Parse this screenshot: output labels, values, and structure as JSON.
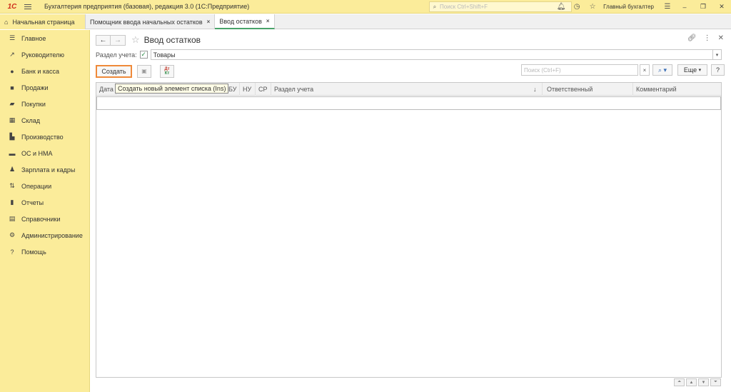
{
  "titlebar": {
    "logo": "1С",
    "app_title": "Бухгалтерия предприятия (базовая), редакция 3.0  (1С:Предприятие)",
    "search_placeholder": "Поиск Ctrl+Shift+F",
    "user": "Главный бухгалтер"
  },
  "tabs": [
    {
      "label": "Начальная страница"
    },
    {
      "label": "Помощник ввода начальных остатков"
    },
    {
      "label": "Ввод остатков"
    }
  ],
  "sidebar": {
    "items": [
      {
        "label": "Главное",
        "icon": "list-icon"
      },
      {
        "label": "Руководителю",
        "icon": "trend-icon"
      },
      {
        "label": "Банк и касса",
        "icon": "coin-icon"
      },
      {
        "label": "Продажи",
        "icon": "bag-icon"
      },
      {
        "label": "Покупки",
        "icon": "cart-icon"
      },
      {
        "label": "Склад",
        "icon": "warehouse-icon"
      },
      {
        "label": "Производство",
        "icon": "factory-icon"
      },
      {
        "label": "ОС и НМА",
        "icon": "truck-icon"
      },
      {
        "label": "Зарплата и кадры",
        "icon": "person-icon"
      },
      {
        "label": "Операции",
        "icon": "dtkt-icon"
      },
      {
        "label": "Отчеты",
        "icon": "chart-icon"
      },
      {
        "label": "Справочники",
        "icon": "book-icon"
      },
      {
        "label": "Администрирование",
        "icon": "gear-icon"
      },
      {
        "label": "Помощь",
        "icon": "help-icon"
      }
    ]
  },
  "form": {
    "title": "Ввод остатков",
    "filter_label": "Раздел учета:",
    "filter_checked": true,
    "filter_value": "Товары",
    "create_label": "Создать",
    "search_placeholder": "Поиск (Ctrl+F)",
    "more_label": "Еще",
    "help_label": "?",
    "tooltip": "Создать новый элемент списка (Ins)"
  },
  "table": {
    "columns": [
      "Дата",
      "БУ",
      "НУ",
      "СР",
      "Раздел учета",
      "Ответственный",
      "Комментарий"
    ]
  },
  "colors": {
    "panel": "#fbec9a",
    "accent_orange": "#ef8a3a",
    "active_tab_green": "#4aa36a"
  }
}
